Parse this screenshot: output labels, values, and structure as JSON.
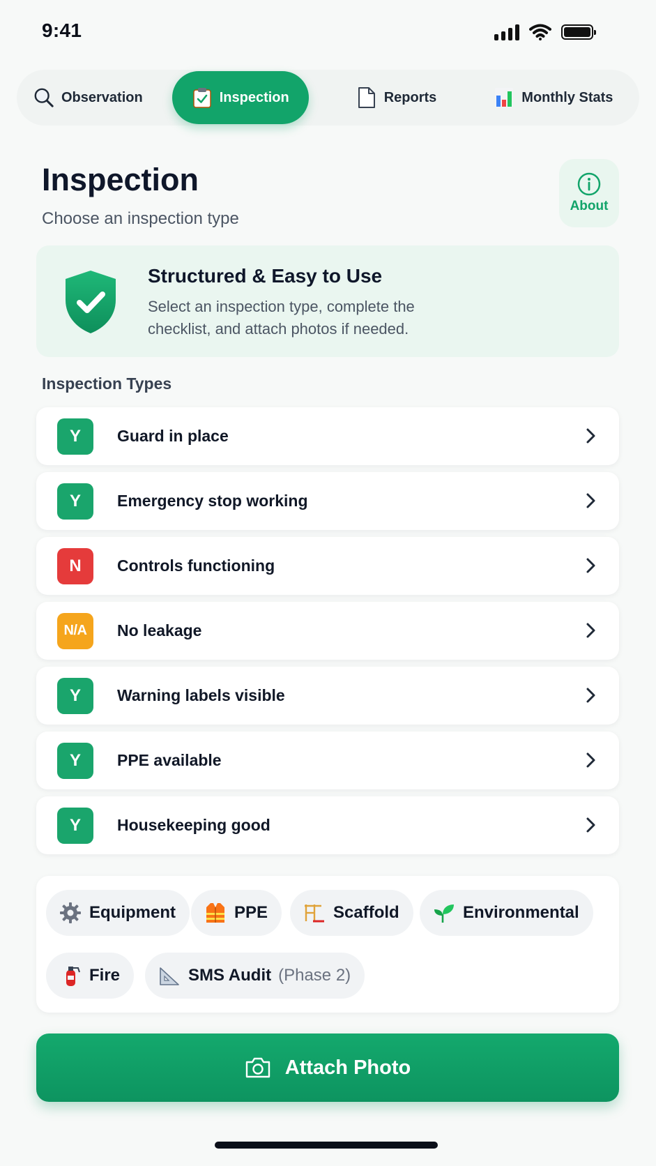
{
  "status_bar": {
    "time": "9:41"
  },
  "tabs": [
    {
      "label": "Observation",
      "icon": "search-icon"
    },
    {
      "label": "Inspection",
      "icon": "clipboard-check-icon",
      "active": true
    },
    {
      "label": "Reports",
      "icon": "document-icon"
    },
    {
      "label": "Monthly Stats",
      "icon": "bar-chart-icon"
    }
  ],
  "header": {
    "title": "Inspection",
    "subtitle": "Choose an inspection type",
    "about_label": "About"
  },
  "banner": {
    "title": "Structured & Easy to Use",
    "text": "Select an inspection type, complete the checklist, and attach photos if needed."
  },
  "section_label": "Inspection Types",
  "items": [
    {
      "badge": "Y",
      "label": "Guard in place",
      "color": "#1aa56c"
    },
    {
      "badge": "Y",
      "label": "Emergency stop working",
      "color": "#1aa56c"
    },
    {
      "badge": "N",
      "label": "Controls functioning",
      "color": "#e53b3b"
    },
    {
      "badge": "N/A",
      "label": "No leakage",
      "color": "#f5a51c"
    },
    {
      "badge": "Y",
      "label": "Warning labels visible",
      "color": "#1aa56c"
    },
    {
      "badge": "Y",
      "label": "PPE available",
      "color": "#1aa56c"
    },
    {
      "badge": "Y",
      "label": "Housekeeping good",
      "color": "#1aa56c"
    }
  ],
  "categories": [
    {
      "label": "Equipment",
      "icon": "gear-icon"
    },
    {
      "label": "PPE",
      "icon": "safety-vest-icon"
    },
    {
      "label": "Scaffold",
      "icon": "scaffold-icon"
    },
    {
      "label": "Environmental",
      "icon": "sprout-icon"
    },
    {
      "label": "Fire",
      "icon": "fire-extinguisher-icon"
    },
    {
      "label": "SMS Audit",
      "phase": "(Phase 2)",
      "icon": "set-square-icon"
    }
  ],
  "attach_button": {
    "label": "Attach Photo",
    "icon": "camera-icon"
  },
  "colors": {
    "accent": "#12a46a",
    "success": "#1aa56c",
    "danger": "#e53b3b",
    "warning": "#f5a51c"
  }
}
